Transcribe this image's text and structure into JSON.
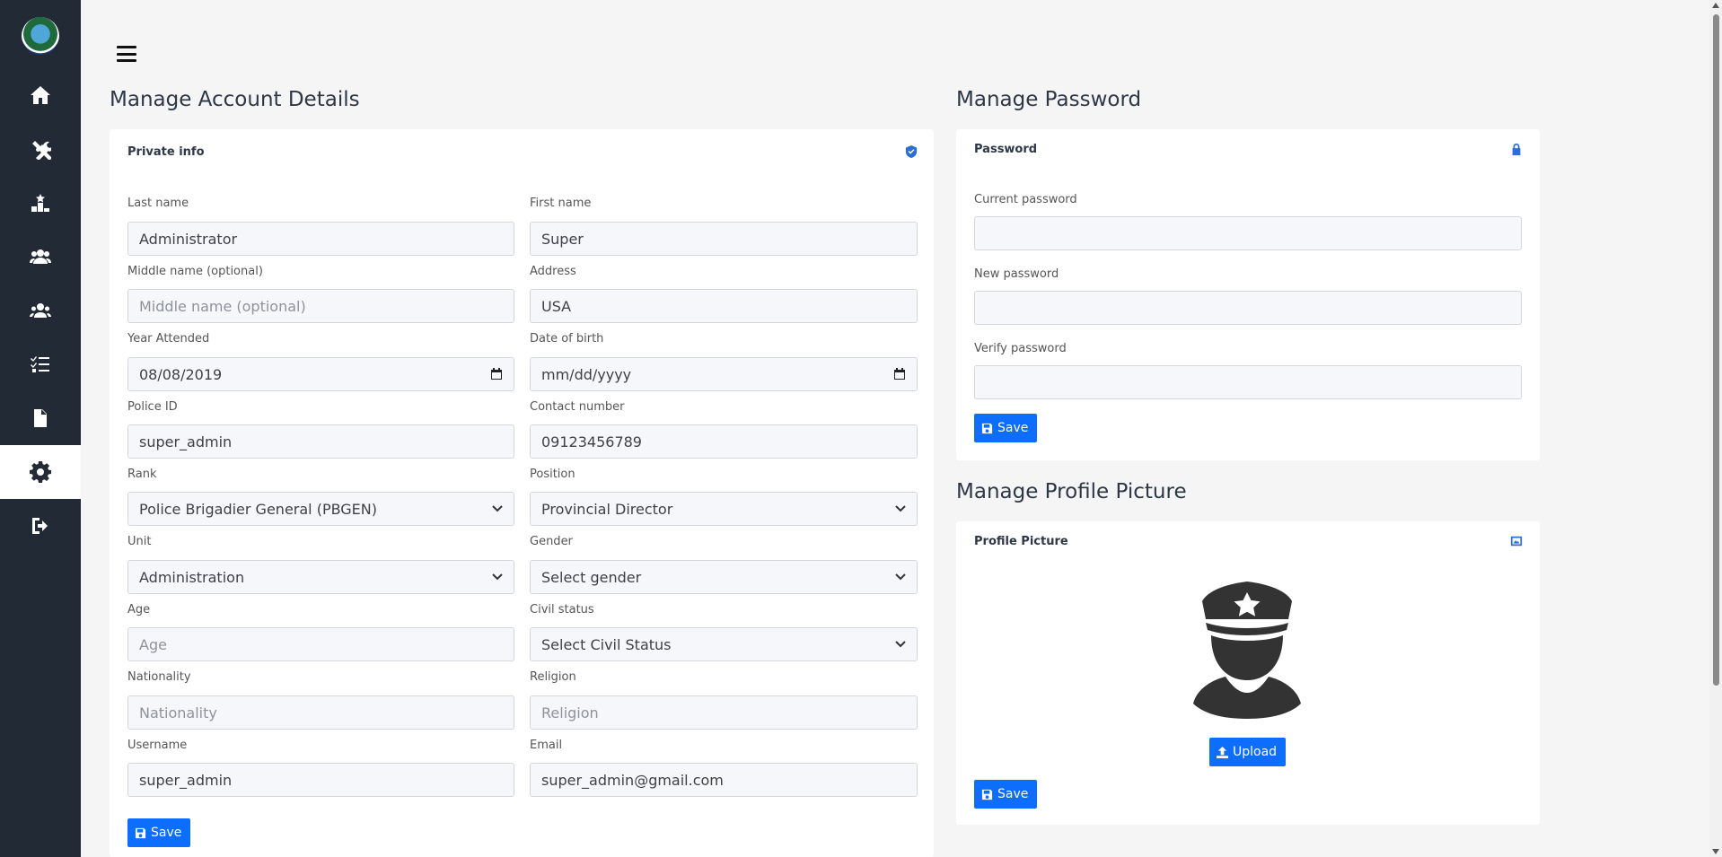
{
  "sidebar": {
    "logo": "police-seal",
    "items": [
      {
        "icon": "home-icon"
      },
      {
        "icon": "tools-icon"
      },
      {
        "icon": "ranking-icon"
      },
      {
        "icon": "users-icon"
      },
      {
        "icon": "user-group-icon"
      },
      {
        "icon": "checklist-icon"
      },
      {
        "icon": "file-check-icon"
      },
      {
        "icon": "gear-icon",
        "active": true
      },
      {
        "icon": "logout-icon"
      }
    ]
  },
  "account": {
    "title": "Manage Account Details",
    "card_title": "Private info",
    "fields": {
      "last_name": {
        "label": "Last name",
        "value": "Administrator"
      },
      "first_name": {
        "label": "First name",
        "value": "Super"
      },
      "middle_name": {
        "label": "Middle name (optional)",
        "placeholder": "Middle name (optional)"
      },
      "address": {
        "label": "Address",
        "value": "USA"
      },
      "year_attended": {
        "label": "Year Attended",
        "value": "08/08/2019"
      },
      "dob": {
        "label": "Date of birth",
        "placeholder": "mm/dd/yyyy"
      },
      "police_id": {
        "label": "Police ID",
        "value": "super_admin"
      },
      "contact": {
        "label": "Contact number",
        "value": "09123456789"
      },
      "rank": {
        "label": "Rank",
        "value": "Police Brigadier General (PBGEN)"
      },
      "position": {
        "label": "Position",
        "value": "Provincial Director"
      },
      "unit": {
        "label": "Unit",
        "value": "Administration"
      },
      "gender": {
        "label": "Gender",
        "value": "Select gender"
      },
      "age": {
        "label": "Age",
        "placeholder": "Age"
      },
      "civil_status": {
        "label": "Civil status",
        "value": "Select Civil Status"
      },
      "nationality": {
        "label": "Nationality",
        "placeholder": "Nationality"
      },
      "religion": {
        "label": "Religion",
        "placeholder": "Religion"
      },
      "username": {
        "label": "Username",
        "value": "super_admin"
      },
      "email": {
        "label": "Email",
        "value": "super_admin@gmail.com"
      }
    },
    "save_label": "Save"
  },
  "password": {
    "title": "Manage Password",
    "card_title": "Password",
    "current_label": "Current password",
    "new_label": "New password",
    "verify_label": "Verify password",
    "save_label": "Save"
  },
  "profile": {
    "title": "Manage Profile Picture",
    "card_title": "Profile Picture",
    "upload_label": "Upload",
    "save_label": "Save"
  },
  "colors": {
    "sidebar": "#222b35",
    "accent": "#0d6efd",
    "background": "#f5f5f5"
  }
}
